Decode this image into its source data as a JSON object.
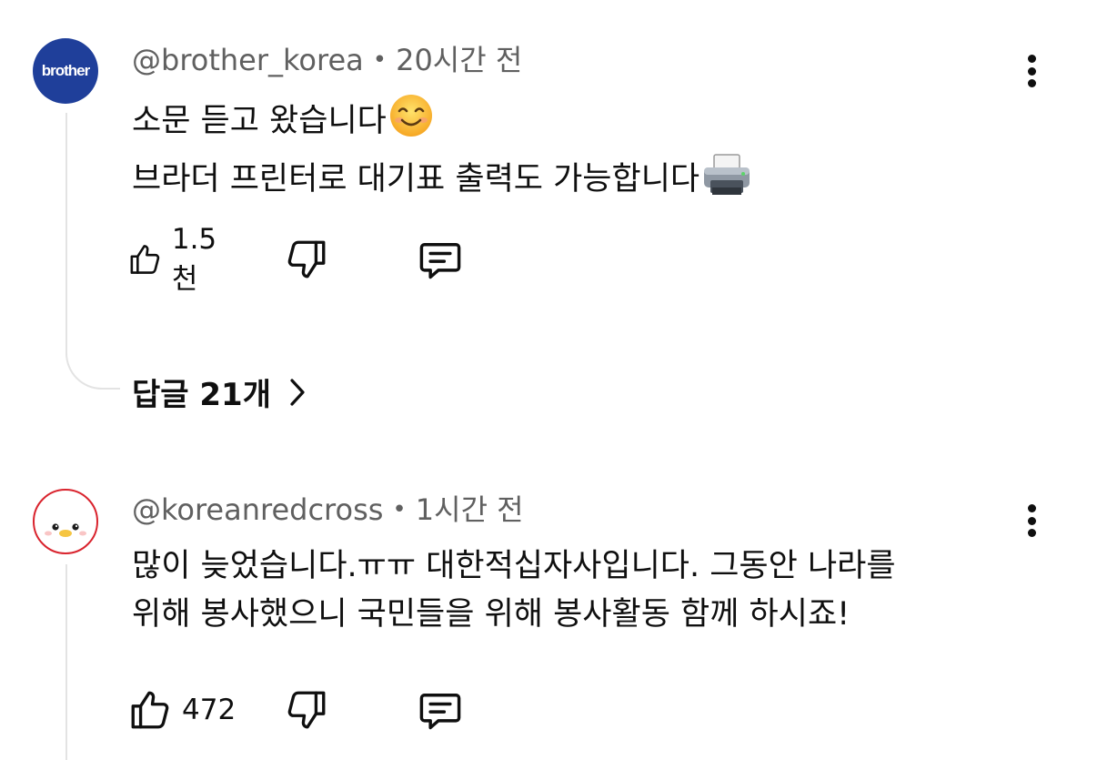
{
  "comments": [
    {
      "avatar": {
        "text": "brother",
        "color": "#1f3f9a"
      },
      "author": "@brother_korea",
      "separator": "•",
      "time": "20시간 전",
      "lines": [
        "소문 듣고 왔습니다",
        "브라더 프린터로 대기표 출력도 가능합니다"
      ],
      "line_emojis": [
        "smiling-face-emoji",
        "printer-emoji"
      ],
      "likes": "1.5천",
      "replies_label": "답글 21개"
    },
    {
      "avatar": {
        "icon": "chick-avatar",
        "border_color": "#d9232d"
      },
      "author": "@koreanredcross",
      "separator": "•",
      "time": "1시간 전",
      "lines": [
        "많이 늦었습니다.ㅠㅠ 대한적십자사입니다. 그동안 나라를",
        "위해 봉사했으니 국민들을 위해 봉사활동 함께 하시죠!"
      ],
      "likes": "472"
    }
  ],
  "icons": {
    "like": "thumbs-up-icon",
    "dislike": "thumbs-down-icon",
    "reply": "reply-comment-icon",
    "more": "more-options-icon",
    "chevron": "chevron-right-icon"
  },
  "colors": {
    "text": "#0f0f0f",
    "meta": "#606060",
    "thread_line": "#e3e3e3"
  }
}
